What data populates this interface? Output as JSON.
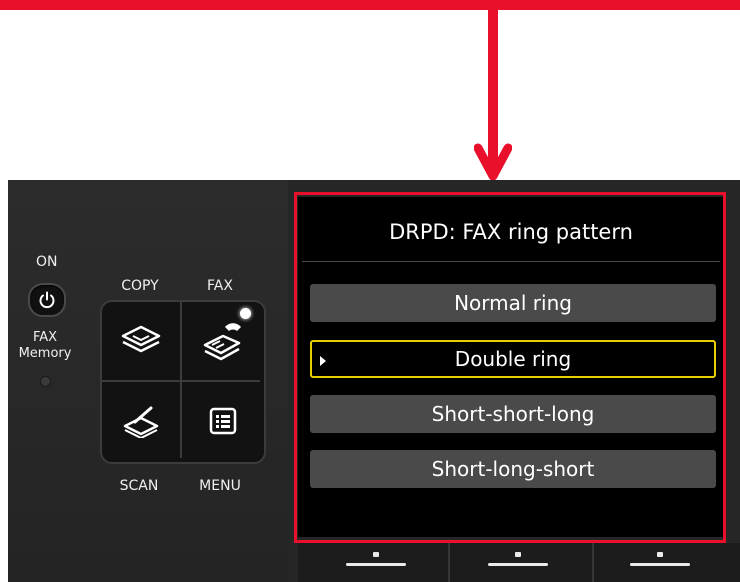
{
  "panel": {
    "on_label": "ON",
    "fax_memory_label_line1": "FAX",
    "fax_memory_label_line2": "Memory",
    "buttons": {
      "copy": "COPY",
      "fax": "FAX",
      "scan": "SCAN",
      "menu": "MENU"
    }
  },
  "screen": {
    "title": "DRPD: FAX ring pattern",
    "options": [
      {
        "label": "Normal ring",
        "selected": false
      },
      {
        "label": "Double ring",
        "selected": true
      },
      {
        "label": "Short-short-long",
        "selected": false
      },
      {
        "label": "Short-long-short",
        "selected": false
      }
    ]
  },
  "colors": {
    "annotation": "#e8102a",
    "selection_border": "#e8d000",
    "panel_background": "#262626",
    "screen_background": "#000000"
  },
  "icons": [
    "power-icon",
    "copy-icon",
    "fax-icon",
    "scan-icon",
    "menu-icon",
    "selection-arrow-icon"
  ]
}
